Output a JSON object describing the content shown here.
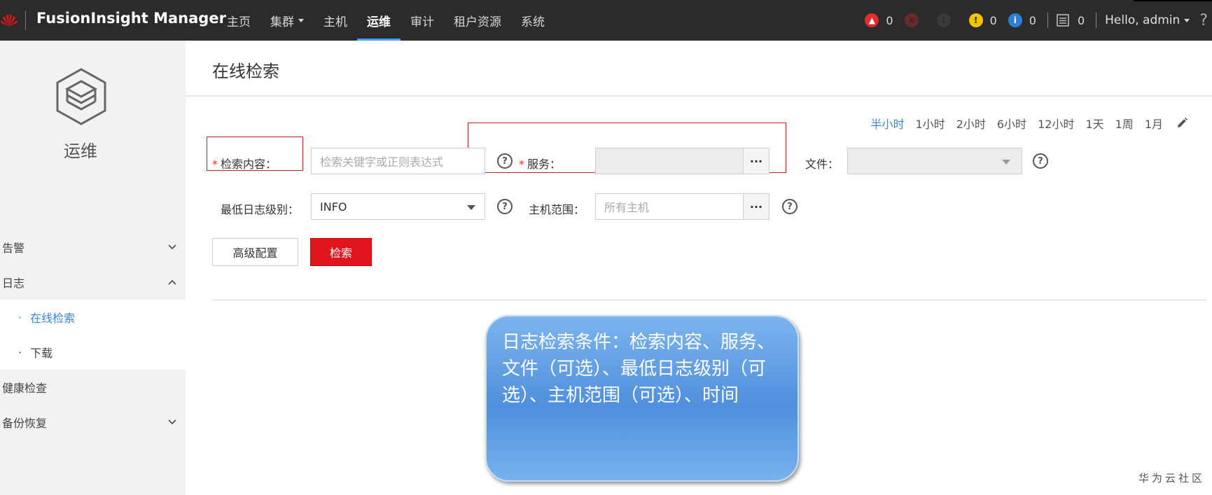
{
  "header": {
    "app_title": "FusionInsight Manager",
    "brand_small": "HUAWEI",
    "nav": [
      {
        "label": "主页"
      },
      {
        "label": "集群"
      },
      {
        "label": "主机"
      },
      {
        "label": "运维"
      },
      {
        "label": "审计"
      },
      {
        "label": "租户资源"
      },
      {
        "label": "系统"
      }
    ],
    "alarms": [
      {
        "count": "0",
        "color": "#e02c2c"
      },
      {
        "count": "",
        "color": "#6b2a2a"
      },
      {
        "count": "",
        "color": "#3a3a3a"
      },
      {
        "count": "0",
        "color": "#f3c400"
      },
      {
        "count": "0",
        "color": "#2f7fd6"
      }
    ],
    "task_count": "0",
    "user_label": "Hello, admin",
    "help_glyph": "?"
  },
  "sidebar": {
    "title": "运维",
    "items": [
      {
        "label": "告警"
      },
      {
        "label": "日志"
      },
      {
        "label": "在线检索"
      },
      {
        "label": "下载"
      },
      {
        "label": "健康检查"
      },
      {
        "label": "备份恢复"
      }
    ]
  },
  "main": {
    "page_title": "在线检索",
    "time_ranges": [
      "半小时",
      "1小时",
      "2小时",
      "6小时",
      "12小时",
      "1天",
      "1周",
      "1月"
    ],
    "form": {
      "search_label": "检索内容：",
      "search_placeholder": "检索关键字或正则表达式",
      "service_label": "服务：",
      "file_label": "文件：",
      "level_label": "最低日志级别：",
      "level_value": "INFO",
      "host_label": "主机范围：",
      "host_placeholder": "所有主机",
      "dots": "···",
      "help_glyph": "?",
      "required_mark": "*"
    },
    "buttons": {
      "advanced": "高级配置",
      "search": "检索"
    },
    "callout_text": "日志检索条件：检索内容、服务、文件（可选）、最低日志级别（可选）、主机范围（可选）、时间",
    "watermark": "华为云社区"
  },
  "colors": {
    "accent": "#3a86d8",
    "primary_button": "#e0151d",
    "topbar": "#2b2b2b"
  }
}
